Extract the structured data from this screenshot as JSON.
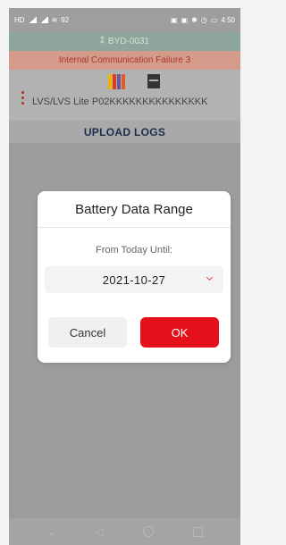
{
  "status_bar": {
    "left_labels": [
      "HD",
      "4G",
      "4G",
      "92"
    ],
    "time": "4:50",
    "right_icons": [
      "nfc-icon",
      "mute-icon",
      "bluetooth-icon",
      "alarm-icon",
      "battery-icon"
    ]
  },
  "device": {
    "name": "BYD-0031",
    "icon": "bluetooth-connected-icon"
  },
  "alarm": {
    "text": "Internal Communication Failure 3",
    "color": "#a83a26"
  },
  "model": {
    "text": "LVS/LVS Lite P02KKKKKKKKKKKKKKK",
    "battery_icon_colors": [
      "#f0b400",
      "#e03a20",
      "#6a5a9a",
      "#e05a2a"
    ]
  },
  "upload": {
    "label": "UPLOAD LOGS"
  },
  "dialog": {
    "title": "Battery Data Range",
    "subtitle": "From Today Until:",
    "date_value": "2021-10-27",
    "cancel_label": "Cancel",
    "ok_label": "OK",
    "accent": "#e4101a"
  },
  "nav": {
    "icons": [
      "chevron-down-icon",
      "back-triangle-icon",
      "home-circle-icon",
      "recent-square-icon"
    ]
  }
}
